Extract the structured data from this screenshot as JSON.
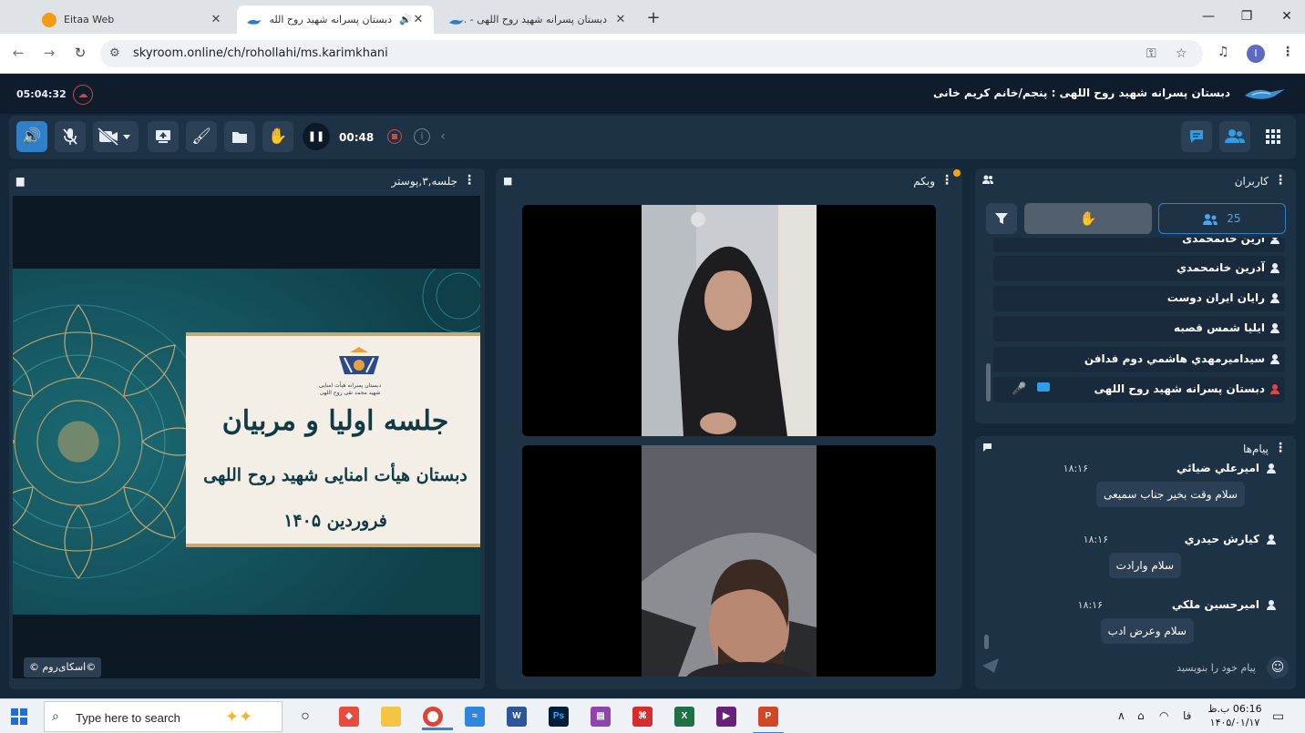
{
  "browser": {
    "tabs": [
      {
        "title": "Eitaa Web",
        "favicon_color": "#f39c12"
      },
      {
        "title": "دبستان پسرانه شهید روح الله",
        "favicon_color": "#2d7fb8",
        "active": true
      },
      {
        "title": "دبستان پسرانه شهید روح اللهی - ...",
        "favicon_color": "#2d7fb8"
      }
    ],
    "url": "skyroom.online/ch/rohollahi/ms.karimkhani",
    "profile_initial": "I"
  },
  "app": {
    "clock": "05:04:32",
    "room_title": "دبستان پسرانه شهید روح اللهی : پنجم/خانم کریم خانی",
    "toolbar": {
      "timer": "00:48"
    },
    "presentation": {
      "title": "جلسه,۳,پوستر",
      "slide_line1": "جلسه اولیا و مربیان",
      "slide_line2": "دبستان هیأت امنایی شهید روح اللهی",
      "slide_line3": "فروردین ۱۴۰۵",
      "slide_logo_line1": "دبستان پسرانه هیأت امنایی",
      "slide_logo_line2": "شهید محمد تقی روح اللهی",
      "copyright": "©اسکای‌روم ©"
    },
    "webcam": {
      "title": "وبکم"
    },
    "users": {
      "title": "کاربران",
      "count": "25",
      "list": [
        {
          "name": "آرین خانمحمدی"
        },
        {
          "name": "آدرین خانمحمدي"
        },
        {
          "name": "رايان ايران دوست"
        },
        {
          "name": "ايليا شمس قصبه"
        },
        {
          "name": "سیدامیرمهدي هاشمي دوم فدافن"
        },
        {
          "name": "دبستان پسرانه شهید روح اللهی",
          "host": true
        }
      ]
    },
    "messages": {
      "title": "پیام‌ها",
      "items": [
        {
          "sender": "اميرعلي ضيائي",
          "time": "۱۸:۱۶",
          "text": "سلام وقت بخير جناب سميعی"
        },
        {
          "sender": "کيارش حيدري",
          "time": "۱۸:۱۶",
          "text": "سلام وارادت"
        },
        {
          "sender": "اميرحسين ملكي",
          "time": "۱۸:۱۶",
          "text": "سلام وعرض ادب"
        }
      ],
      "input_placeholder": "پیام خود را بنویسید"
    }
  },
  "taskbar": {
    "search_placeholder": "Type here to search",
    "lang": "فا",
    "time": "06:16 ب.ظ",
    "date": "۱۴۰۵/۰۱/۱۷"
  }
}
